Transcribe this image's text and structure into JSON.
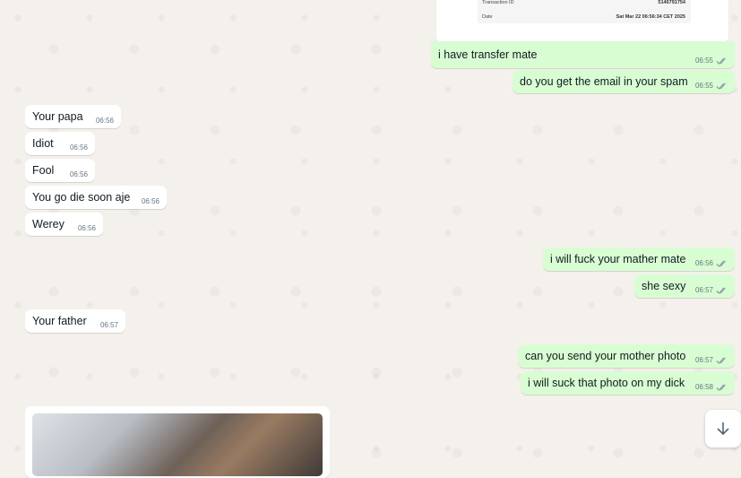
{
  "receipt": {
    "transaction_label": "Transaction ID",
    "transaction_value": "5146791754",
    "date_label": "Date",
    "date_value": "Sat Mar 22 06:56:34 CET 2025"
  },
  "messages": [
    {
      "direction": "out",
      "text": "i have transfer mate",
      "time": "06:55",
      "status": "read"
    },
    {
      "direction": "out",
      "text": "do you get the email in your spam",
      "time": "06:55",
      "status": "read"
    },
    {
      "direction": "in",
      "text": "Your papa",
      "time": "06:56"
    },
    {
      "direction": "in",
      "text": "Idiot",
      "time": "06:56"
    },
    {
      "direction": "in",
      "text": "Fool",
      "time": "06:56"
    },
    {
      "direction": "in",
      "text": "You go die soon aje",
      "time": "06:56"
    },
    {
      "direction": "in",
      "text": "Werey",
      "time": "06:56"
    },
    {
      "direction": "out",
      "text": "i will fuck your mather mate",
      "time": "06:56",
      "status": "read"
    },
    {
      "direction": "out",
      "text": "she sexy",
      "time": "06:57",
      "status": "read"
    },
    {
      "direction": "in",
      "text": "Your father",
      "time": "06:57"
    },
    {
      "direction": "out",
      "text": "can you send your mother photo",
      "time": "06:57",
      "status": "read"
    },
    {
      "direction": "out",
      "text": "i will suck that photo on my dick",
      "time": "06:58",
      "status": "read"
    }
  ],
  "icons": {
    "read_ticks": "double-check-icon",
    "scroll_down": "arrow-down-icon"
  },
  "colors": {
    "incoming_bubble": "#ffffff",
    "outgoing_bubble": "#d9fdd3",
    "background": "#f4f1ec",
    "read_ticks": "#8696a0"
  }
}
